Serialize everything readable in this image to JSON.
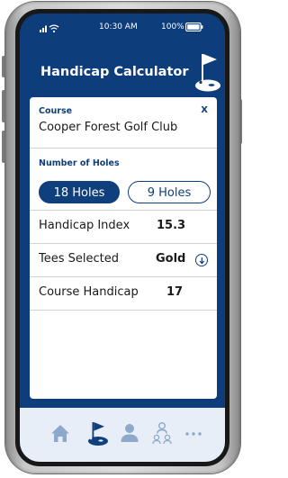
{
  "status": {
    "time": "10:30 AM",
    "battery": "100%"
  },
  "header": {
    "title": "Handicap Calculator",
    "icon": "golf-flag-icon"
  },
  "course": {
    "label": "Course",
    "close": "X",
    "name": "Cooper Forest Golf Club"
  },
  "holes": {
    "label": "Number of Holes",
    "options": [
      {
        "label": "18 Holes",
        "selected": true
      },
      {
        "label": "9 Holes",
        "selected": false
      }
    ]
  },
  "rows": {
    "handicap_index": {
      "label": "Handicap Index",
      "value": "15.3"
    },
    "tees": {
      "label": "Tees Selected",
      "value": "Gold",
      "icon": "info-icon"
    },
    "course_handicap": {
      "label": "Course Handicap",
      "value": "17"
    }
  },
  "nav": {
    "items": [
      {
        "icon": "home-icon",
        "active": false
      },
      {
        "icon": "golf-flag-icon",
        "active": true
      },
      {
        "icon": "user-icon",
        "active": false
      },
      {
        "icon": "group-icon",
        "active": false
      },
      {
        "icon": "more-icon",
        "active": false
      }
    ]
  },
  "colors": {
    "primary": "#0f3f7c",
    "header_bg": "#0d3d7a",
    "nav_bg": "#e8eef7",
    "nav_inactive": "#8ea8cc"
  }
}
